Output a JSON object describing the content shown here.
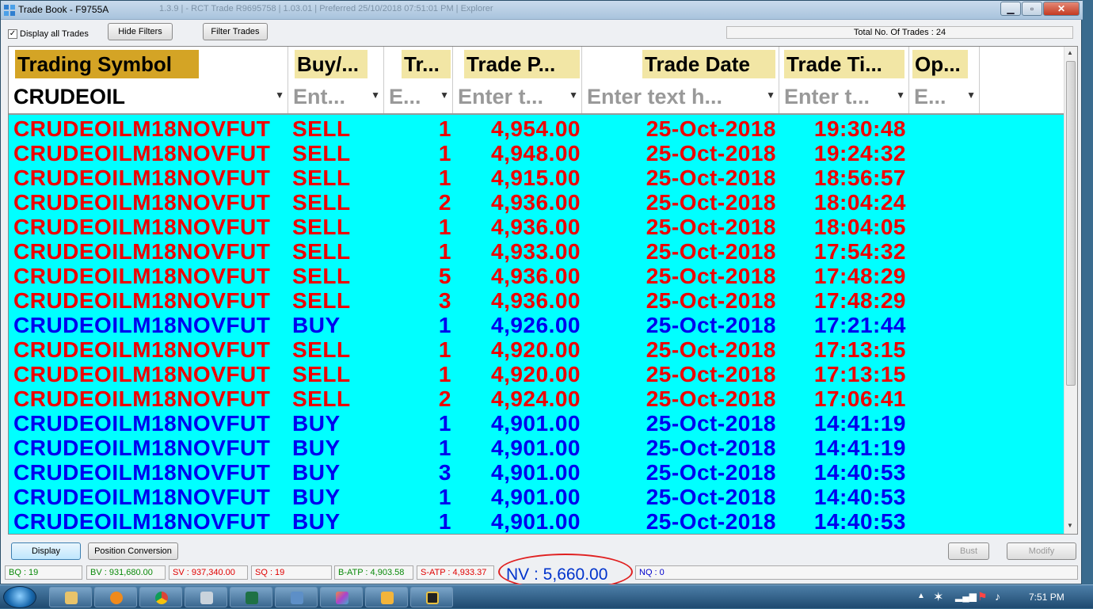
{
  "window": {
    "title": "Trade Book - F9755A",
    "faded_title": "1.3.9 | - RCT Trade R9695758 | 1.03.01 | Preferred 25/10/2018 07:51:01 PM | Explorer"
  },
  "toolbar": {
    "display_all_label": "Display all Trades",
    "display_all_checked": "✓",
    "hide_filters_label": "Hide Filters",
    "filter_trades_label": "Filter Trades",
    "total_trades_label": "Total No. Of Trades : 24"
  },
  "columns": [
    {
      "header": "Trading Symbol",
      "filter": "CRUDEOIL",
      "is_value": true
    },
    {
      "header": "Buy/...",
      "filter": "Ent...",
      "is_value": false
    },
    {
      "header": "Tr...",
      "filter": "E...",
      "is_value": false
    },
    {
      "header": "Trade P...",
      "filter": "Enter t...",
      "is_value": false
    },
    {
      "header": "Trade Date",
      "filter": "Enter text h...",
      "is_value": false
    },
    {
      "header": "Trade Ti...",
      "filter": "Enter t...",
      "is_value": false
    },
    {
      "header": "Op...",
      "filter": "E...",
      "is_value": false
    }
  ],
  "trades": [
    {
      "symbol": "CRUDEOILM18NOVFUT",
      "side": "SELL",
      "qty": "1",
      "price": "4,954.00",
      "date": "25-Oct-2018",
      "time": "19:30:48"
    },
    {
      "symbol": "CRUDEOILM18NOVFUT",
      "side": "SELL",
      "qty": "1",
      "price": "4,948.00",
      "date": "25-Oct-2018",
      "time": "19:24:32"
    },
    {
      "symbol": "CRUDEOILM18NOVFUT",
      "side": "SELL",
      "qty": "1",
      "price": "4,915.00",
      "date": "25-Oct-2018",
      "time": "18:56:57"
    },
    {
      "symbol": "CRUDEOILM18NOVFUT",
      "side": "SELL",
      "qty": "2",
      "price": "4,936.00",
      "date": "25-Oct-2018",
      "time": "18:04:24"
    },
    {
      "symbol": "CRUDEOILM18NOVFUT",
      "side": "SELL",
      "qty": "1",
      "price": "4,936.00",
      "date": "25-Oct-2018",
      "time": "18:04:05"
    },
    {
      "symbol": "CRUDEOILM18NOVFUT",
      "side": "SELL",
      "qty": "1",
      "price": "4,933.00",
      "date": "25-Oct-2018",
      "time": "17:54:32"
    },
    {
      "symbol": "CRUDEOILM18NOVFUT",
      "side": "SELL",
      "qty": "5",
      "price": "4,936.00",
      "date": "25-Oct-2018",
      "time": "17:48:29"
    },
    {
      "symbol": "CRUDEOILM18NOVFUT",
      "side": "SELL",
      "qty": "3",
      "price": "4,936.00",
      "date": "25-Oct-2018",
      "time": "17:48:29"
    },
    {
      "symbol": "CRUDEOILM18NOVFUT",
      "side": "BUY",
      "qty": "1",
      "price": "4,926.00",
      "date": "25-Oct-2018",
      "time": "17:21:44"
    },
    {
      "symbol": "CRUDEOILM18NOVFUT",
      "side": "SELL",
      "qty": "1",
      "price": "4,920.00",
      "date": "25-Oct-2018",
      "time": "17:13:15"
    },
    {
      "symbol": "CRUDEOILM18NOVFUT",
      "side": "SELL",
      "qty": "1",
      "price": "4,920.00",
      "date": "25-Oct-2018",
      "time": "17:13:15"
    },
    {
      "symbol": "CRUDEOILM18NOVFUT",
      "side": "SELL",
      "qty": "2",
      "price": "4,924.00",
      "date": "25-Oct-2018",
      "time": "17:06:41"
    },
    {
      "symbol": "CRUDEOILM18NOVFUT",
      "side": "BUY",
      "qty": "1",
      "price": "4,901.00",
      "date": "25-Oct-2018",
      "time": "14:41:19"
    },
    {
      "symbol": "CRUDEOILM18NOVFUT",
      "side": "BUY",
      "qty": "1",
      "price": "4,901.00",
      "date": "25-Oct-2018",
      "time": "14:41:19"
    },
    {
      "symbol": "CRUDEOILM18NOVFUT",
      "side": "BUY",
      "qty": "3",
      "price": "4,901.00",
      "date": "25-Oct-2018",
      "time": "14:40:53"
    },
    {
      "symbol": "CRUDEOILM18NOVFUT",
      "side": "BUY",
      "qty": "1",
      "price": "4,901.00",
      "date": "25-Oct-2018",
      "time": "14:40:53"
    },
    {
      "symbol": "CRUDEOILM18NOVFUT",
      "side": "BUY",
      "qty": "1",
      "price": "4,901.00",
      "date": "25-Oct-2018",
      "time": "14:40:53"
    }
  ],
  "colors": {
    "sell": "#ee0000",
    "buy": "#0000ee",
    "grid_bg": "#00ffff",
    "header_bg": "#f2e6a5"
  },
  "bottom": {
    "display_label": "Display",
    "position_conversion_label": "Position Conversion",
    "bust_label": "Bust",
    "modify_label": "Modify"
  },
  "status": {
    "bq": "BQ : 19",
    "bv": "BV : 931,680.00",
    "sv": "SV : 937,340.00",
    "sq": "SQ : 19",
    "batp": "B-ATP : 4,903.58",
    "satp": "S-ATP : 4,933.37",
    "nv": "NV : 5,660.00",
    "nq": "NQ : 0"
  },
  "taskbar": {
    "clock": "7:51 PM"
  }
}
